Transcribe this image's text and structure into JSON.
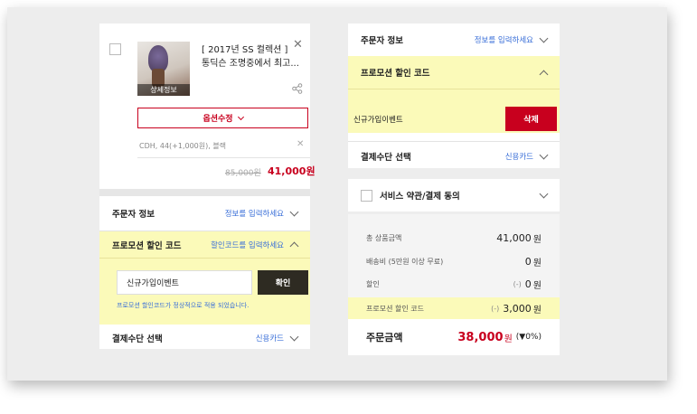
{
  "product": {
    "image_label": "상세정보",
    "title_line1": "[ 2017년 SS 컬렉션 ]",
    "title_line2": "통딕슨 조명중에서 최고...",
    "option_button": "옵션수정",
    "option_text": "CDH, 44(+1,000원), 블랙",
    "original_price": "85,000원",
    "price": "41,000원"
  },
  "left": {
    "orderer_label": "주문자 정보",
    "orderer_value": "정보를 입력하세요",
    "promo_label": "프로모션 할인 코드",
    "promo_value": "할인코드를 입력하세요",
    "promo_input_value": "신규가입이벤트",
    "promo_apply": "확인",
    "promo_notice": "프로모션 할인코드가 정상적으로 적용 되었습니다.",
    "payment_label": "결제수단 선택",
    "payment_value": "신용카드"
  },
  "right": {
    "orderer_label": "주문자 정보",
    "orderer_value": "정보를 입력하세요",
    "promo_label": "프로모션 할인 코드",
    "promo_code_name": "신규가입이벤트",
    "delete_button": "삭제",
    "payment_label": "결제수단 선택",
    "payment_value": "신용카드",
    "terms_label": "서비스 약관/결제 동의",
    "summary": {
      "subtotal_label": "총 상품금액",
      "subtotal_value": "41,000",
      "shipping_label": "배송비 (5만원 이상 무료)",
      "shipping_value": "0",
      "discount_label": "할인",
      "discount_prefix": "(-)",
      "discount_value": "0",
      "promo_label": "프로모션 할인 코드",
      "promo_prefix": "(-)",
      "promo_value": "3,000",
      "won": "원",
      "total_label": "주문금액",
      "total_value": "38,000",
      "total_won": "원",
      "total_rate": "(▼0%)"
    }
  },
  "colors": {
    "accent_red": "#c8001e",
    "link_blue": "#3a6fd8",
    "highlight_yellow": "#fbfab9",
    "dark_button": "#2e2b22"
  }
}
